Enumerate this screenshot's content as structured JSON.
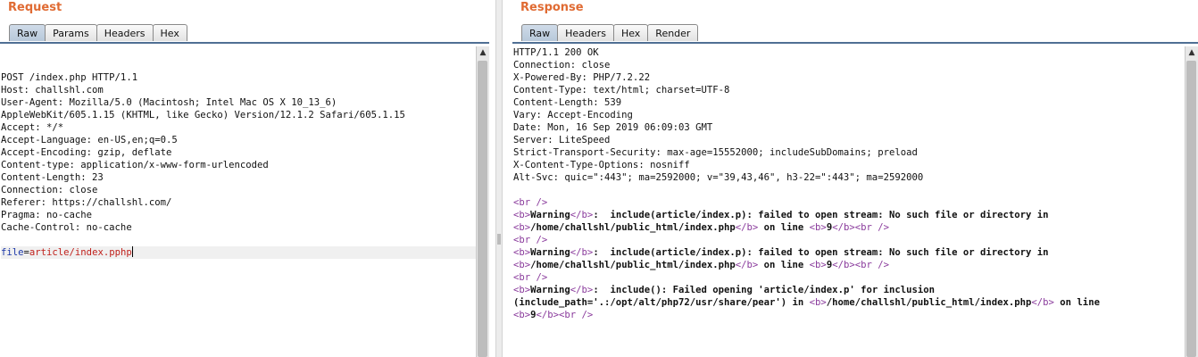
{
  "request": {
    "title": "Request",
    "tabs": [
      "Raw",
      "Params",
      "Headers",
      "Hex"
    ],
    "active_tab": "Raw",
    "lines": [
      "POST /index.php HTTP/1.1",
      "Host: challshl.com",
      "User-Agent: Mozilla/5.0 (Macintosh; Intel Mac OS X 10_13_6)",
      "AppleWebKit/605.1.15 (KHTML, like Gecko) Version/12.1.2 Safari/605.1.15",
      "Accept: */*",
      "Accept-Language: en-US,en;q=0.5",
      "Accept-Encoding: gzip, deflate",
      "Content-type: application/x-www-form-urlencoded",
      "Content-Length: 23",
      "Connection: close",
      "Referer: https://challshl.com/",
      "Pragma: no-cache",
      "Cache-Control: no-cache",
      ""
    ],
    "body_param_name": "file",
    "body_param_eq": "=",
    "body_param_value": "article/index.pphp"
  },
  "response": {
    "title": "Response",
    "tabs": [
      "Raw",
      "Headers",
      "Hex",
      "Render"
    ],
    "active_tab": "Raw",
    "header_lines": [
      "HTTP/1.1 200 OK",
      "Connection: close",
      "X-Powered-By: PHP/7.2.22",
      "Content-Type: text/html; charset=UTF-8",
      "Content-Length: 539",
      "Vary: Accept-Encoding",
      "Date: Mon, 16 Sep 2019 06:09:03 GMT",
      "Server: LiteSpeed",
      "Strict-Transport-Security: max-age=15552000; includeSubDomains; preload",
      "X-Content-Type-Options: nosniff",
      "Alt-Svc: quic=\":443\"; ma=2592000; v=\"39,43,46\", h3-22=\":443\"; ma=2592000",
      ""
    ],
    "body_lines": [
      [
        {
          "t": "<br />",
          "c": "tag"
        }
      ],
      [
        {
          "t": "<b>",
          "c": "tag"
        },
        {
          "t": "Warning",
          "c": "b"
        },
        {
          "t": "</b>",
          "c": "tag"
        },
        {
          "t": ":  include(article/index.p): failed to open stream: No such file or directory in",
          "c": "b"
        }
      ],
      [
        {
          "t": "<b>",
          "c": "tag"
        },
        {
          "t": "/home/challshl/public_html/index.php",
          "c": "b"
        },
        {
          "t": "</b>",
          "c": "tag"
        },
        {
          "t": " on line ",
          "c": "b"
        },
        {
          "t": "<b>",
          "c": "tag"
        },
        {
          "t": "9",
          "c": "b"
        },
        {
          "t": "</b>",
          "c": "tag"
        },
        {
          "t": "<br />",
          "c": "tag"
        }
      ],
      [
        {
          "t": "<br />",
          "c": "tag"
        }
      ],
      [
        {
          "t": "<b>",
          "c": "tag"
        },
        {
          "t": "Warning",
          "c": "b"
        },
        {
          "t": "</b>",
          "c": "tag"
        },
        {
          "t": ":  include(article/index.p): failed to open stream: No such file or directory in",
          "c": "b"
        }
      ],
      [
        {
          "t": "<b>",
          "c": "tag"
        },
        {
          "t": "/home/challshl/public_html/index.php",
          "c": "b"
        },
        {
          "t": "</b>",
          "c": "tag"
        },
        {
          "t": " on line ",
          "c": "b"
        },
        {
          "t": "<b>",
          "c": "tag"
        },
        {
          "t": "9",
          "c": "b"
        },
        {
          "t": "</b>",
          "c": "tag"
        },
        {
          "t": "<br />",
          "c": "tag"
        }
      ],
      [
        {
          "t": "<br />",
          "c": "tag"
        }
      ],
      [
        {
          "t": "<b>",
          "c": "tag"
        },
        {
          "t": "Warning",
          "c": "b"
        },
        {
          "t": "</b>",
          "c": "tag"
        },
        {
          "t": ":  include(): Failed opening 'article/index.p' for inclusion",
          "c": "b"
        }
      ],
      [
        {
          "t": "(include_path='.:/opt/alt/php72/usr/share/pear') in ",
          "c": "b"
        },
        {
          "t": "<b>",
          "c": "tag"
        },
        {
          "t": "/home/challshl/public_html/index.php",
          "c": "b"
        },
        {
          "t": "</b>",
          "c": "tag"
        },
        {
          "t": " on line",
          "c": "b"
        }
      ],
      [
        {
          "t": "<b>",
          "c": "tag"
        },
        {
          "t": "9",
          "c": "b"
        },
        {
          "t": "</b>",
          "c": "tag"
        },
        {
          "t": "<br />",
          "c": "tag"
        }
      ]
    ]
  },
  "icons": {
    "scroll_up": "scroll-up-arrow-icon"
  }
}
